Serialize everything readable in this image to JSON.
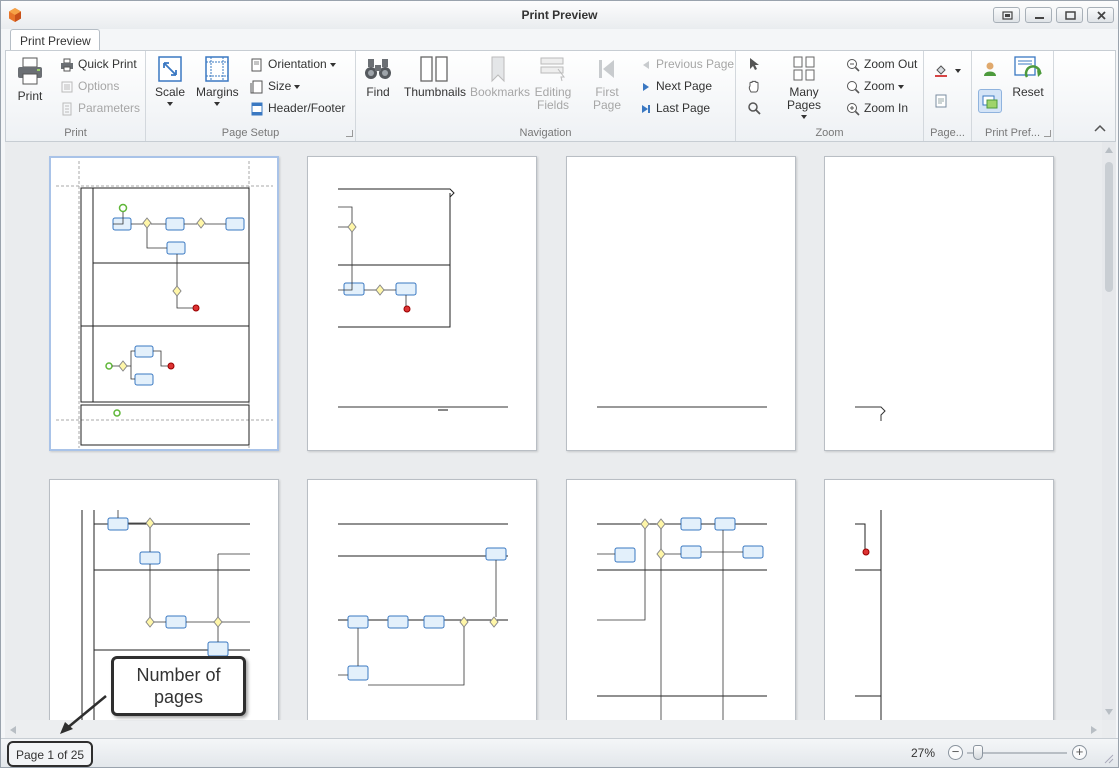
{
  "window": {
    "title": "Print Preview"
  },
  "tabs": [
    {
      "label": "Print Preview"
    }
  ],
  "ribbon": {
    "print_group": {
      "label": "Print",
      "print": "Print",
      "quick_print": "Quick Print",
      "options": "Options",
      "parameters": "Parameters"
    },
    "page_setup_group": {
      "label": "Page Setup",
      "scale": "Scale",
      "margins": "Margins",
      "orientation": "Orientation",
      "size": "Size",
      "header_footer": "Header/Footer"
    },
    "navigation_group": {
      "label": "Navigation",
      "find": "Find",
      "thumbnails": "Thumbnails",
      "bookmarks": "Bookmarks",
      "editing_fields_1": "Editing",
      "editing_fields_2": "Fields",
      "first_page_1": "First",
      "first_page_2": "Page",
      "previous_page": "Previous Page",
      "next_page": "Next Page",
      "last_page": "Last Page"
    },
    "zoom_group": {
      "label": "Zoom",
      "many_pages": "Many Pages",
      "zoom_out": "Zoom Out",
      "zoom": "Zoom",
      "zoom_in": "Zoom In"
    },
    "page_background_group": {
      "label": "Page..."
    },
    "print_preferences_group": {
      "label": "Print Pref...",
      "reset": "Reset"
    }
  },
  "callout": {
    "line1": "Number of",
    "line2": "pages"
  },
  "status": {
    "page_info": "Page 1 of 25",
    "zoom_level": "27%"
  }
}
